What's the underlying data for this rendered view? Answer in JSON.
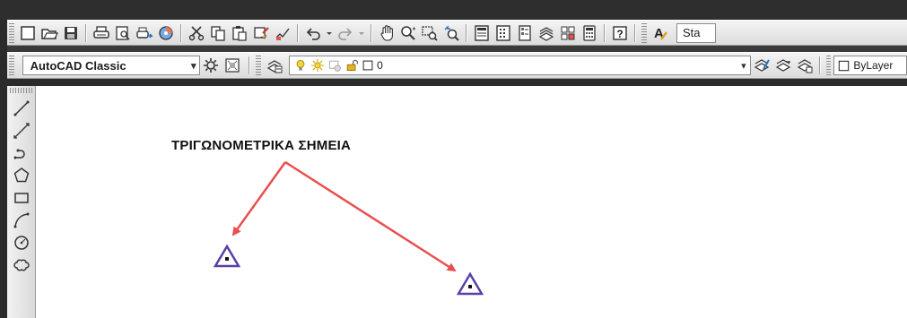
{
  "toolbar_standard": {
    "buttons": [
      {
        "name": "new-icon"
      },
      {
        "name": "open-icon"
      },
      {
        "name": "save-icon"
      },
      {
        "name": "print-icon"
      },
      {
        "name": "print-preview-icon"
      },
      {
        "name": "publish-icon"
      },
      {
        "name": "3d-print-icon"
      },
      {
        "name": "cut-icon"
      },
      {
        "name": "copy-icon"
      },
      {
        "name": "paste-icon"
      },
      {
        "name": "match-properties-icon"
      },
      {
        "name": "block-editor-icon"
      },
      {
        "name": "undo-icon"
      },
      {
        "name": "redo-icon"
      },
      {
        "name": "pan-icon"
      },
      {
        "name": "zoom-realtime-icon"
      },
      {
        "name": "zoom-window-icon"
      },
      {
        "name": "zoom-previous-icon"
      },
      {
        "name": "properties-icon"
      },
      {
        "name": "design-center-icon"
      },
      {
        "name": "tool-palettes-icon"
      },
      {
        "name": "sheet-set-icon"
      },
      {
        "name": "markup-icon"
      },
      {
        "name": "calculator-icon"
      },
      {
        "name": "help-icon"
      }
    ],
    "text_style_label": "Sta"
  },
  "toolbar_layers": {
    "workspace_value": "AutoCAD Classic",
    "current_layer": "0",
    "color_value": "ByLayer"
  },
  "draw_toolbar": {
    "tools": [
      "line-icon",
      "construction-line-icon",
      "polyline-icon",
      "polygon-icon",
      "rectangle-icon",
      "arc-icon",
      "circle-icon",
      "revision-cloud-icon"
    ]
  },
  "canvas": {
    "annotation": "ΤΡΙΓΩΝΟΜΕΤΡΙΚΑ ΣΗΜΕΙΑ"
  },
  "colors": {
    "arrow": "#e8504f",
    "triangle": "#5b3fa8"
  }
}
